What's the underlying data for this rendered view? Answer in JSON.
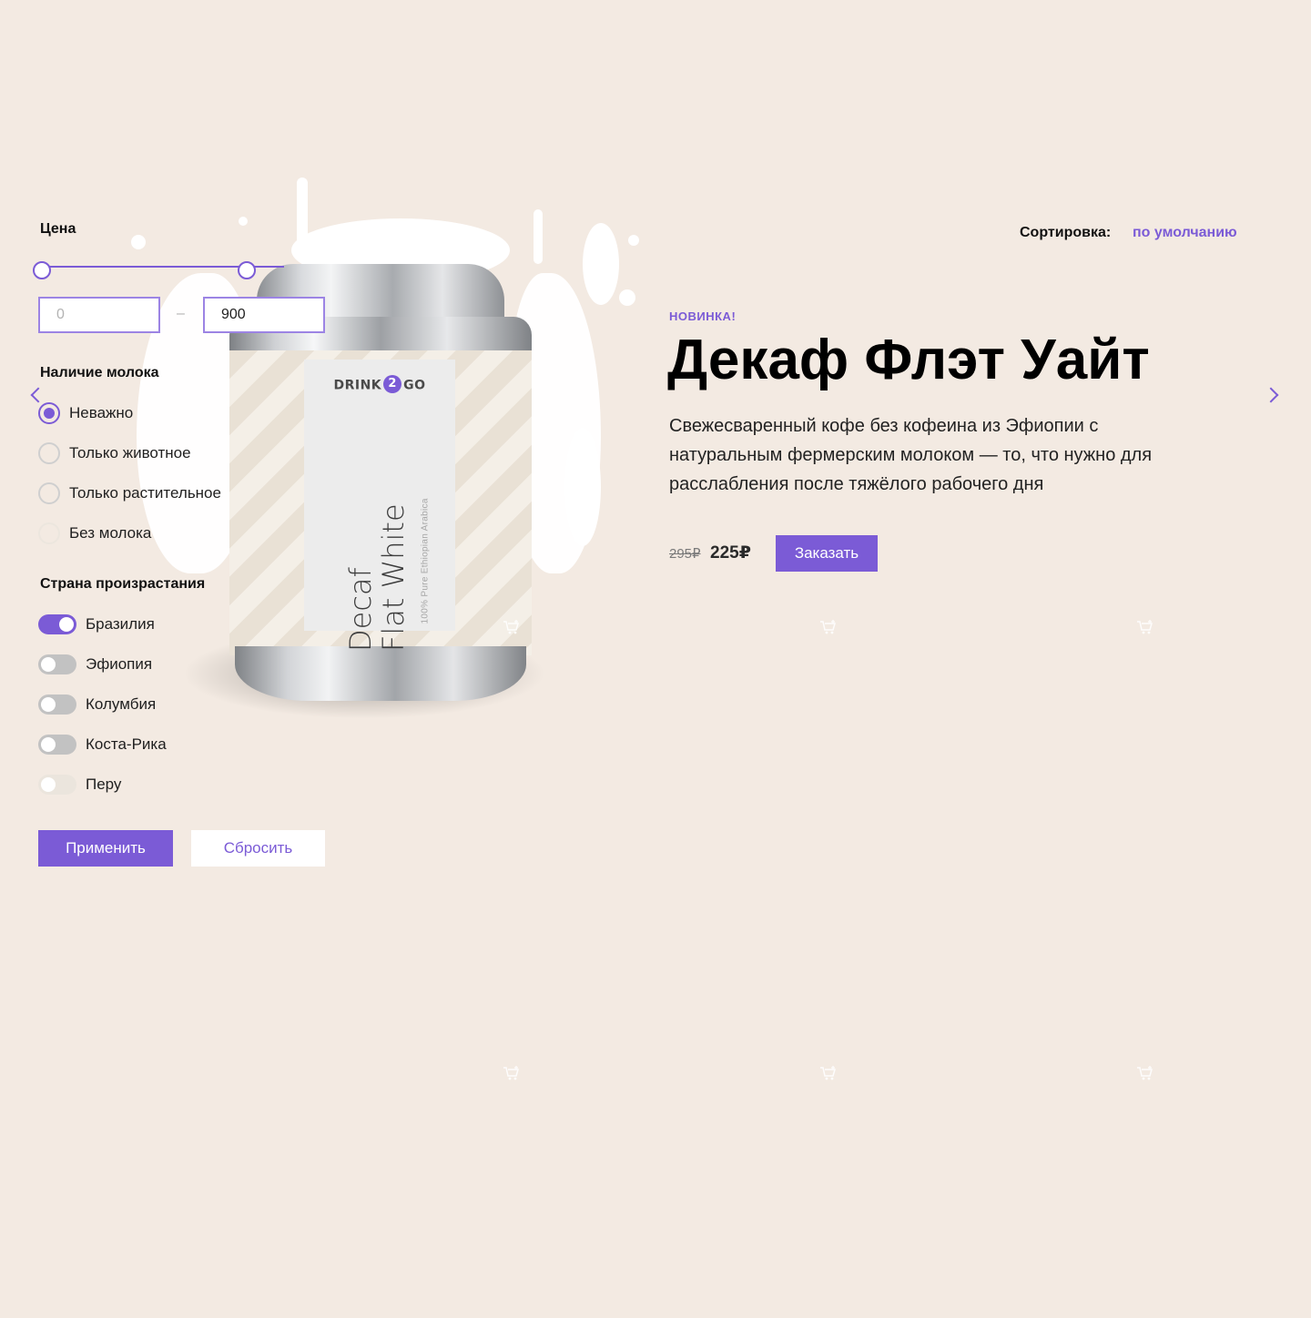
{
  "colors": {
    "accent": "#7b5bd6",
    "background": "#f3eae2"
  },
  "filters": {
    "price": {
      "title": "Цена",
      "min_placeholder": "0",
      "max_value": "900",
      "separator": "–"
    },
    "milk": {
      "title": "Наличие молока",
      "options": [
        {
          "label": "Неважно",
          "state": "checked"
        },
        {
          "label": "Только животное",
          "state": "unchecked"
        },
        {
          "label": "Только растительное",
          "state": "unchecked"
        },
        {
          "label": "Без молока",
          "state": "disabled"
        }
      ]
    },
    "country": {
      "title": "Страна произрастания",
      "options": [
        {
          "label": "Бразилия",
          "state": "on"
        },
        {
          "label": "Эфиопия",
          "state": "off"
        },
        {
          "label": "Колумбия",
          "state": "off"
        },
        {
          "label": "Коста-Рика",
          "state": "off"
        },
        {
          "label": "Перу",
          "state": "disabled"
        }
      ]
    },
    "apply_label": "Применить",
    "reset_label": "Сбросить"
  },
  "sort": {
    "label": "Сортировка:",
    "value": "по умолчанию"
  },
  "product": {
    "badge": "НОВИНКА!",
    "title": "Декаф Флэт Уайт",
    "description": "Свежесваренный кофе без кофеина из Эфиопии с натуральным фермерским молоком — то, что нужно для расслабления после тяжёлого рабочего дня",
    "old_price": "295₽",
    "new_price": "225₽",
    "order_label": "Заказать",
    "can": {
      "brand_left": "DRINK",
      "brand_mark": "2",
      "brand_right": "GO",
      "name_line1": "Decaf",
      "name_line2": "Flat White",
      "subtitle": "100% Pure Ethiopian Arabica"
    }
  },
  "slider_nav": {
    "prev_icon": "chevron-left-icon",
    "next_icon": "chevron-right-icon"
  },
  "cart_icons": [
    "add-to-cart-icon",
    "add-to-cart-icon",
    "add-to-cart-icon",
    "add-to-cart-icon",
    "add-to-cart-icon",
    "add-to-cart-icon"
  ]
}
